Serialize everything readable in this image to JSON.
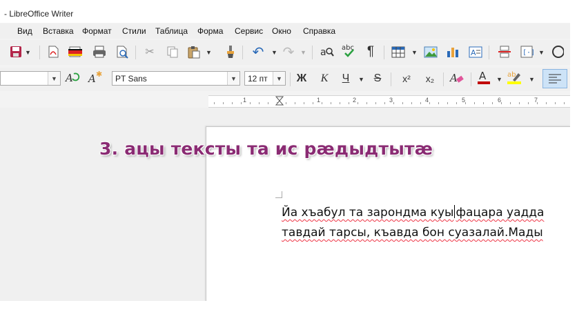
{
  "window": {
    "title": "- LibreOffice Writer"
  },
  "menu": [
    "Вид",
    "Вставка",
    "Формат",
    "Стили",
    "Таблица",
    "Форма",
    "Сервис",
    "Окно",
    "Справка"
  ],
  "toolbar2": {
    "font_name": "PT Sans",
    "font_size": "12 пт",
    "bold_label": "Ж",
    "italic_label": "К",
    "underline_label": "Ч",
    "strike_label": "S",
    "superscript_label": "x²",
    "subscript_label": "x₂"
  },
  "ruler": {
    "numbers": [
      "1",
      "1",
      "2",
      "3",
      "4",
      "5",
      "6",
      "7"
    ]
  },
  "annotation": "3. ацы тексты та ис рæдыдтытæ",
  "document": {
    "line1_before_cursor": "Йа хъабул та зарондма куы",
    "line1_after_cursor": "фацара уадда",
    "line2": "тавдай тарсы, къавда бон суазалай.Мады"
  },
  "colors": {
    "annotation": "#8a2b73",
    "font_color": "#c00000",
    "highlight": "#ffff00"
  }
}
